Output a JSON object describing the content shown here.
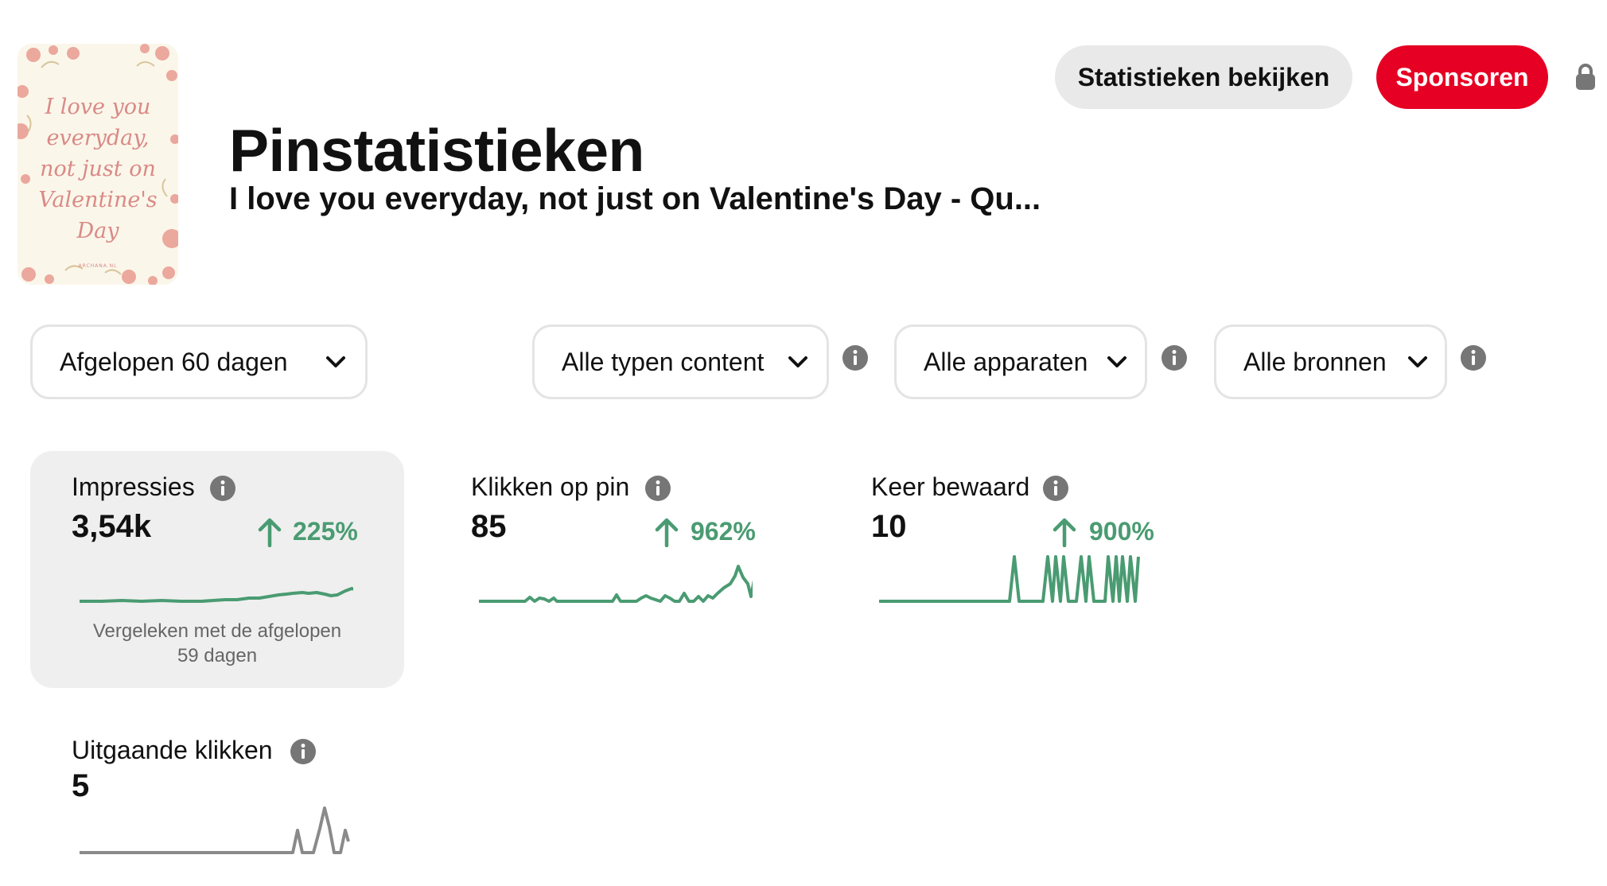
{
  "pin": {
    "image_text": "I love you\neveryday,\nnot just on\nValentine's\nDay",
    "image_credit": "ARCHANA.NL"
  },
  "header": {
    "title": "Pinstatistieken",
    "subtitle": "I love you everyday, not just on Valentine's Day - Qu..."
  },
  "actions": {
    "stats_label": "Statistieken bekijken",
    "sponsor_label": "Sponsoren"
  },
  "filters": {
    "date_range": "Afgelopen 60 dagen",
    "content_type": "Alle typen content",
    "devices": "Alle apparaten",
    "sources": "Alle bronnen"
  },
  "metrics": {
    "impressions": {
      "label": "Impressies",
      "value": "3,54k",
      "change": "225%"
    },
    "pin_clicks": {
      "label": "Klikken op pin",
      "value": "85",
      "change": "962%"
    },
    "saves": {
      "label": "Keer bewaard",
      "value": "10",
      "change": "900%"
    },
    "outbound_clicks": {
      "label": "Uitgaande klikken",
      "value": "5"
    }
  },
  "compare_note": "Vergeleken met de afgelopen\n59 dagen",
  "colors": {
    "accent_red": "#e60023",
    "positive_green": "#4a9b72",
    "neutral_gray": "#8a8a8a",
    "card_bg": "#efefef"
  }
}
